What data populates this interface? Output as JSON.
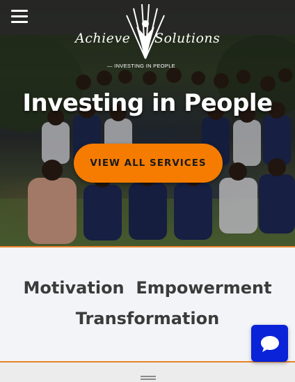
{
  "header": {
    "menu_icon": "hamburger-menu-icon",
    "logo": {
      "word_left": "Achieve",
      "word_right": "Solutions",
      "tagline": "— INVESTING IN PEOPLE"
    }
  },
  "hero": {
    "title": "Investing in People",
    "cta_label": "VIEW ALL SERVICES"
  },
  "values": {
    "line1": "Motivation  Empowerment",
    "line2": "Transformation"
  },
  "chat": {
    "icon": "chat-bubble-icon"
  },
  "colors": {
    "accent": "#f57c00",
    "chat": "#0a22d8",
    "text_dark": "#3b3b3b",
    "rule": "#e8822a"
  }
}
